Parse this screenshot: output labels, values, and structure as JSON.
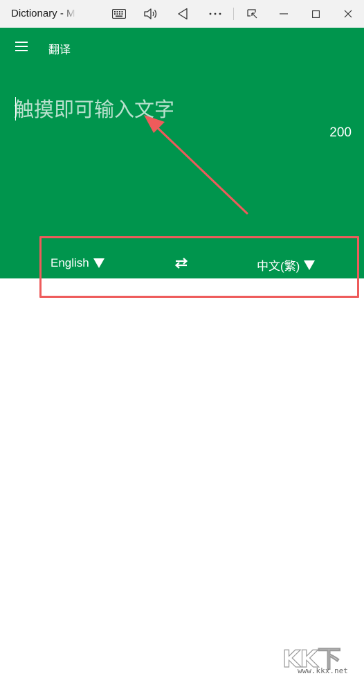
{
  "window": {
    "title": "Dictionary - M"
  },
  "titlebar_icons": [
    "keyboard-icon",
    "speaker-icon",
    "back-triangle-icon",
    "more-icon",
    "snap-icon",
    "minimize-icon",
    "maximize-icon",
    "close-icon"
  ],
  "header": {
    "title": "翻译",
    "menu_icon": "hamburger-icon"
  },
  "input": {
    "placeholder": "触摸即可输入文字",
    "value": "",
    "char_limit": "200"
  },
  "languages": {
    "source": "English",
    "target": "中文(繁)",
    "swap_icon": "swap-arrows-icon"
  },
  "colors": {
    "accent": "#00954d",
    "titlebar": "#f2f2f2",
    "annotation": "#ee5b5b"
  },
  "watermark": {
    "logo": "KK下载",
    "url": "www.kkx.net"
  }
}
